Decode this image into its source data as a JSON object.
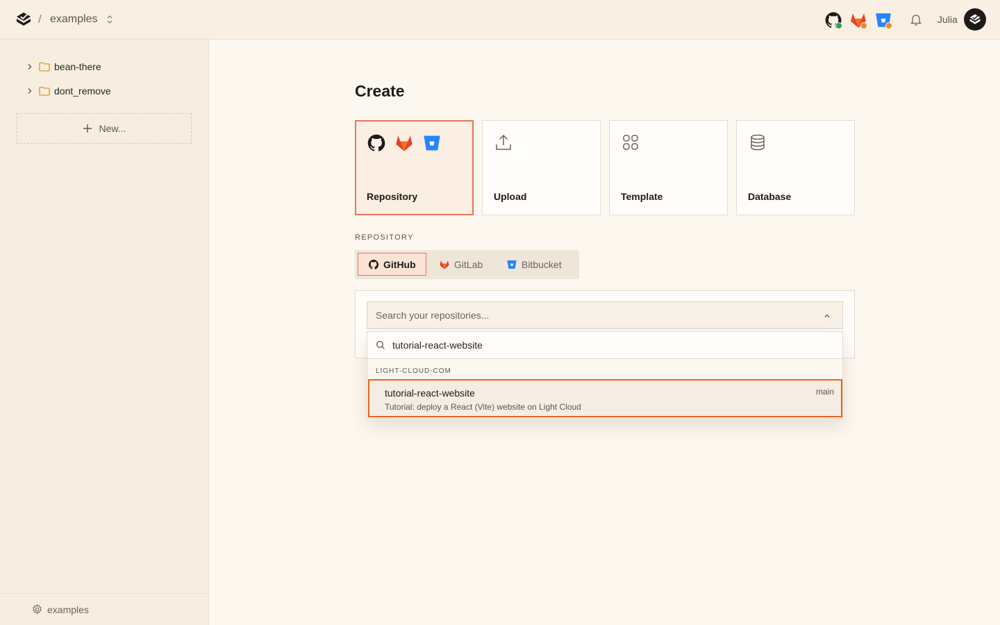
{
  "topbar": {
    "breadcrumb_sep": "/",
    "project": "examples",
    "username": "Julia",
    "status": {
      "github": "#2da44e",
      "gitlab": "#f08a24",
      "bitbucket": "#f08a24"
    }
  },
  "sidebar": {
    "items": [
      {
        "label": "bean-there",
        "icon": "folder-icon"
      },
      {
        "label": "dont_remove",
        "icon": "folder-icon"
      }
    ],
    "new_label": "New...",
    "footer_label": "examples"
  },
  "main": {
    "title": "Create",
    "cards": [
      {
        "label": "Repository",
        "icons": [
          "github-icon",
          "gitlab-icon",
          "bitbucket-icon"
        ],
        "active": true
      },
      {
        "label": "Upload",
        "icon": "upload-icon"
      },
      {
        "label": "Template",
        "icon": "grid-icon"
      },
      {
        "label": "Database",
        "icon": "database-icon"
      }
    ],
    "section_label": "REPOSITORY",
    "providers": [
      {
        "label": "GitHub",
        "active": true
      },
      {
        "label": "GitLab"
      },
      {
        "label": "Bitbucket"
      }
    ],
    "select_placeholder": "Search your repositories...",
    "dropdown": {
      "search_value": "tutorial-react-website",
      "group_label": "LIGHT-CLOUD-COM",
      "result": {
        "name": "tutorial-react-website",
        "description": "Tutorial: deploy a React (Vite) website on Light Cloud",
        "branch": "main"
      }
    }
  },
  "colors": {
    "accent": "#e2785a",
    "highlight": "#e0651f",
    "folder": "#d99a2b",
    "bitbucket": "#2684ff",
    "gitlab": "#e2432a"
  }
}
